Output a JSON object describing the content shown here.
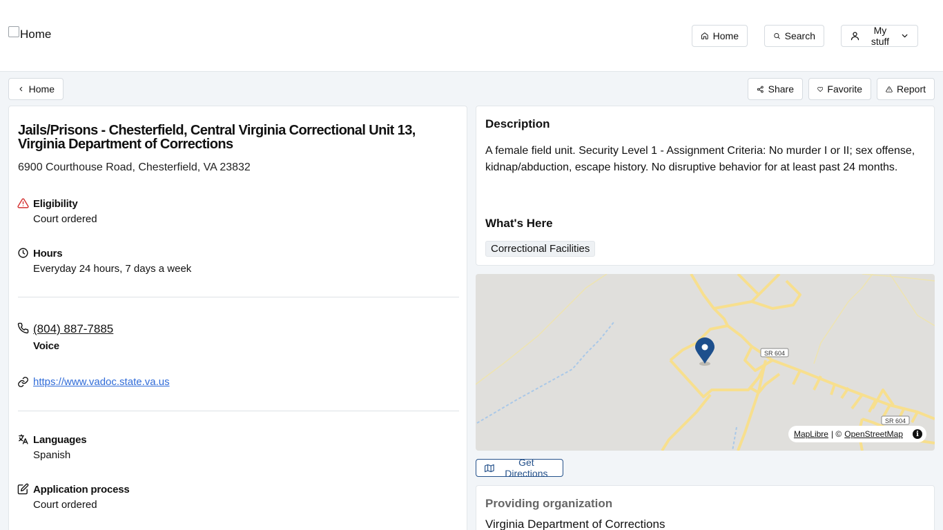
{
  "header": {
    "logo_alt": "Home",
    "nav": {
      "home_label": "Home",
      "search_label": "Search",
      "mystuff_label": "My stuff"
    }
  },
  "subbar": {
    "back_label": "Home",
    "share_label": "Share",
    "favorite_label": "Favorite",
    "report_label": "Report"
  },
  "service": {
    "title": "Jails/Prisons - Chesterfield, Central Virginia Correctional Unit 13, Virginia Department of Corrections",
    "address": "6900 Courthouse Road, Chesterfield, VA 23832",
    "eligibility": {
      "label": "Eligibility",
      "value": "Court ordered"
    },
    "hours": {
      "label": "Hours",
      "value": "Everyday 24 hours, 7 days a week"
    },
    "phone": {
      "number": "(804) 887-7885",
      "type": "Voice"
    },
    "website": "https://www.vadoc.state.va.us",
    "languages": {
      "label": "Languages",
      "value": "Spanish"
    },
    "application": {
      "label": "Application process",
      "value": "Court ordered"
    }
  },
  "description": {
    "heading": "Description",
    "text": "A female field unit. Security Level 1 - Assignment Criteria: No murder I or II; sex offense, kidnap/abduction, escape history. No disruptive behavior for at least past 24 months.",
    "whats_here_heading": "What's Here",
    "tags": [
      "Correctional Facilities"
    ]
  },
  "map": {
    "road_label_1": "SR 604",
    "road_label_2": "SR 604",
    "attribution_maplibre": "MapLibre",
    "attribution_sep": "| ©",
    "attribution_osm": "OpenStreetMap",
    "colors": {
      "background": "#e0dfdc",
      "road": "#f7df8e",
      "water": "#a9c8e8",
      "marker": "#1d4f8c"
    }
  },
  "directions_label": "Get Directions",
  "organization": {
    "heading": "Providing organization",
    "name": "Virginia Department of Corrections"
  }
}
